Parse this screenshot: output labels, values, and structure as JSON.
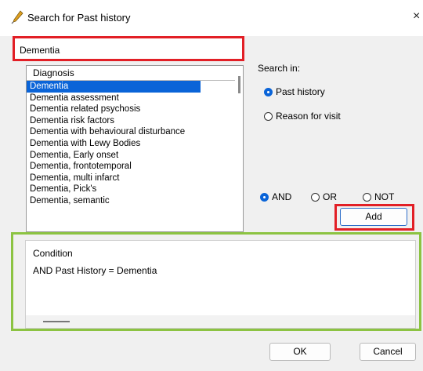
{
  "window": {
    "title": "Search for Past history",
    "close_glyph": "×",
    "icon": "pen-icon"
  },
  "search": {
    "value": "Dementia"
  },
  "list": {
    "header": "Diagnosis",
    "items": [
      "Dementia",
      "Dementia assessment",
      "Dementia related psychosis",
      "Dementia risk factors",
      "Dementia with behavioural disturbance",
      "Dementia with Lewy Bodies",
      "Dementia, Early onset",
      "Dementia, frontotemporal",
      "Dementia, multi infarct",
      "Dementia, Pick's",
      "Dementia, semantic"
    ],
    "selected_index": 0
  },
  "search_in": {
    "label": "Search in:",
    "options": [
      "Past history",
      "Reason for visit"
    ],
    "selected": "Past history"
  },
  "logic": {
    "options": [
      "AND",
      "OR",
      "NOT"
    ],
    "selected": "AND"
  },
  "buttons": {
    "add": "Add",
    "ok": "OK",
    "cancel": "Cancel"
  },
  "conditions": {
    "header": "Condition",
    "rows": [
      "AND Past History = Dementia"
    ]
  },
  "colors": {
    "accent": "#0a64d8",
    "highlight_red": "#e21f26",
    "highlight_green": "#8cc342"
  }
}
